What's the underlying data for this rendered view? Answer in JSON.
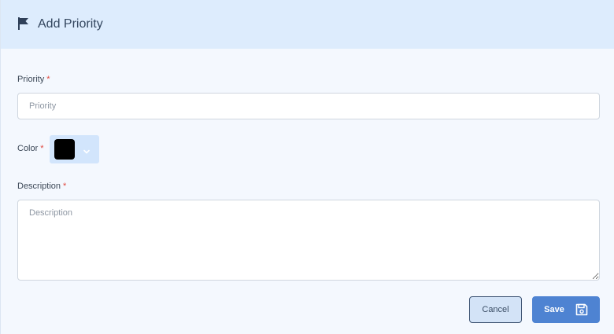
{
  "dialog": {
    "title": "Add Priority",
    "title_icon": "flag-icon"
  },
  "form": {
    "priority": {
      "label": "Priority",
      "required_mark": "*",
      "placeholder": "Priority",
      "value": ""
    },
    "color": {
      "label": "Color",
      "required_mark": "*",
      "selected_color": "#000000",
      "dropdown_icon": "chevron-down-icon"
    },
    "description": {
      "label": "Description",
      "required_mark": "*",
      "placeholder": "Description",
      "value": ""
    }
  },
  "actions": {
    "cancel_label": "Cancel",
    "save_label": "Save",
    "save_icon": "floppy-disk-icon"
  },
  "colors": {
    "header_bg": "#ddecfd",
    "body_bg": "#f4f8fe",
    "primary": "#4e83d2",
    "required": "#e0453b"
  }
}
